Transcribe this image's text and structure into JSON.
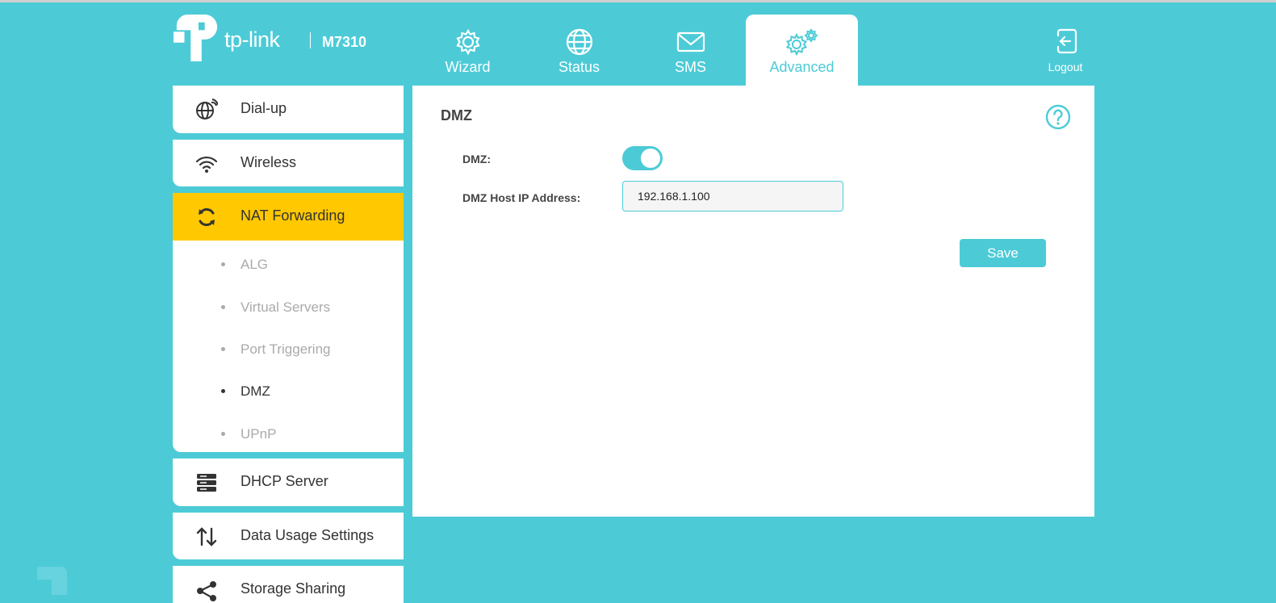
{
  "brand": {
    "logo_text": "tp-link",
    "model": "M7310"
  },
  "nav": {
    "tabs": [
      {
        "label": "Wizard",
        "icon": "gear-icon"
      },
      {
        "label": "Status",
        "icon": "globe-icon"
      },
      {
        "label": "SMS",
        "icon": "envelope-icon"
      },
      {
        "label": "Advanced",
        "icon": "gears-icon",
        "active": true
      }
    ],
    "logout_label": "Logout"
  },
  "sidebar": {
    "items": [
      {
        "label": "Dial-up",
        "icon": "dialup-globe-icon"
      },
      {
        "label": "Wireless",
        "icon": "wifi-icon"
      },
      {
        "label": "NAT Forwarding",
        "icon": "nat-forwarding-icon",
        "active": true
      },
      {
        "label": "DHCP Server",
        "icon": "server-icon"
      },
      {
        "label": "Data Usage Settings",
        "icon": "data-usage-icon"
      },
      {
        "label": "Storage Sharing",
        "icon": "share-icon"
      }
    ],
    "subitems": [
      {
        "label": "ALG"
      },
      {
        "label": "Virtual Servers"
      },
      {
        "label": "Port Triggering"
      },
      {
        "label": "DMZ",
        "current": true
      },
      {
        "label": "UPnP"
      }
    ]
  },
  "main": {
    "title": "DMZ",
    "dmz_label": "DMZ:",
    "dmz_enabled": true,
    "host_label": "DMZ Host IP Address:",
    "host_value": "192.168.1.100",
    "save_label": "Save"
  },
  "colors": {
    "accent": "#4ccbd7",
    "highlight": "#ffc800",
    "text": "#333333",
    "muted": "#aaaaaa"
  }
}
